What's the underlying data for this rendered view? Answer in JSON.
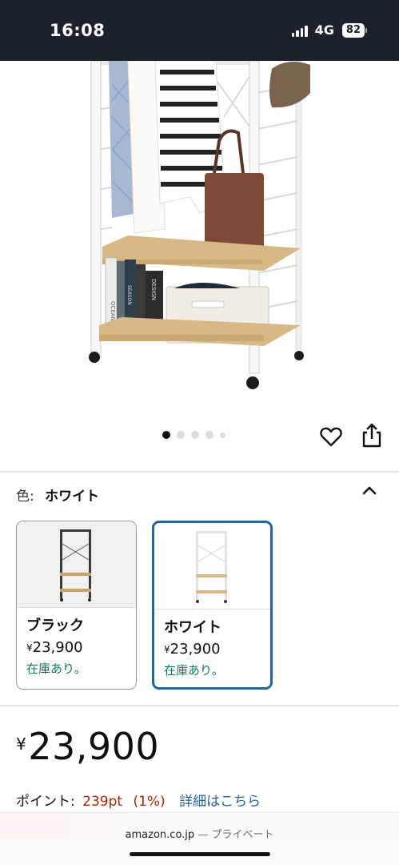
{
  "status_bar": {
    "time": "16:08",
    "network": "4G",
    "battery": "82"
  },
  "carousel": {
    "dot_count": 5,
    "active_index": 0
  },
  "product_image": {
    "book_spines": [
      "OCEAN",
      "SEASON",
      "DESIGN"
    ]
  },
  "color_selector": {
    "label": "色:",
    "selected": "ホワイト",
    "variants": [
      {
        "name": "ブラック",
        "yen": "¥",
        "price": "23,900",
        "stock": "在庫あり。",
        "selected": false
      },
      {
        "name": "ホワイト",
        "yen": "¥",
        "price": "23,900",
        "stock": "在庫あり。",
        "selected": true
      }
    ]
  },
  "price": {
    "yen": "¥",
    "amount": "23,900"
  },
  "points": {
    "label": "ポイント:",
    "value": "239pt",
    "percent": "(1%)",
    "link": "詳細はこちら"
  },
  "browser": {
    "domain": "amazon.co.jp",
    "private_label": "— プライベート"
  },
  "colors": {
    "status_bar_bg": "#1b222b",
    "link_blue": "#2162a1",
    "stock_green": "#067d62",
    "points_red": "#b12704",
    "shelf_wood": "#d8b885",
    "frame_white": "#f4f4f4"
  },
  "icons": {
    "wishlist": "heart-icon",
    "share": "share-icon",
    "collapse": "chevron-up-icon"
  }
}
